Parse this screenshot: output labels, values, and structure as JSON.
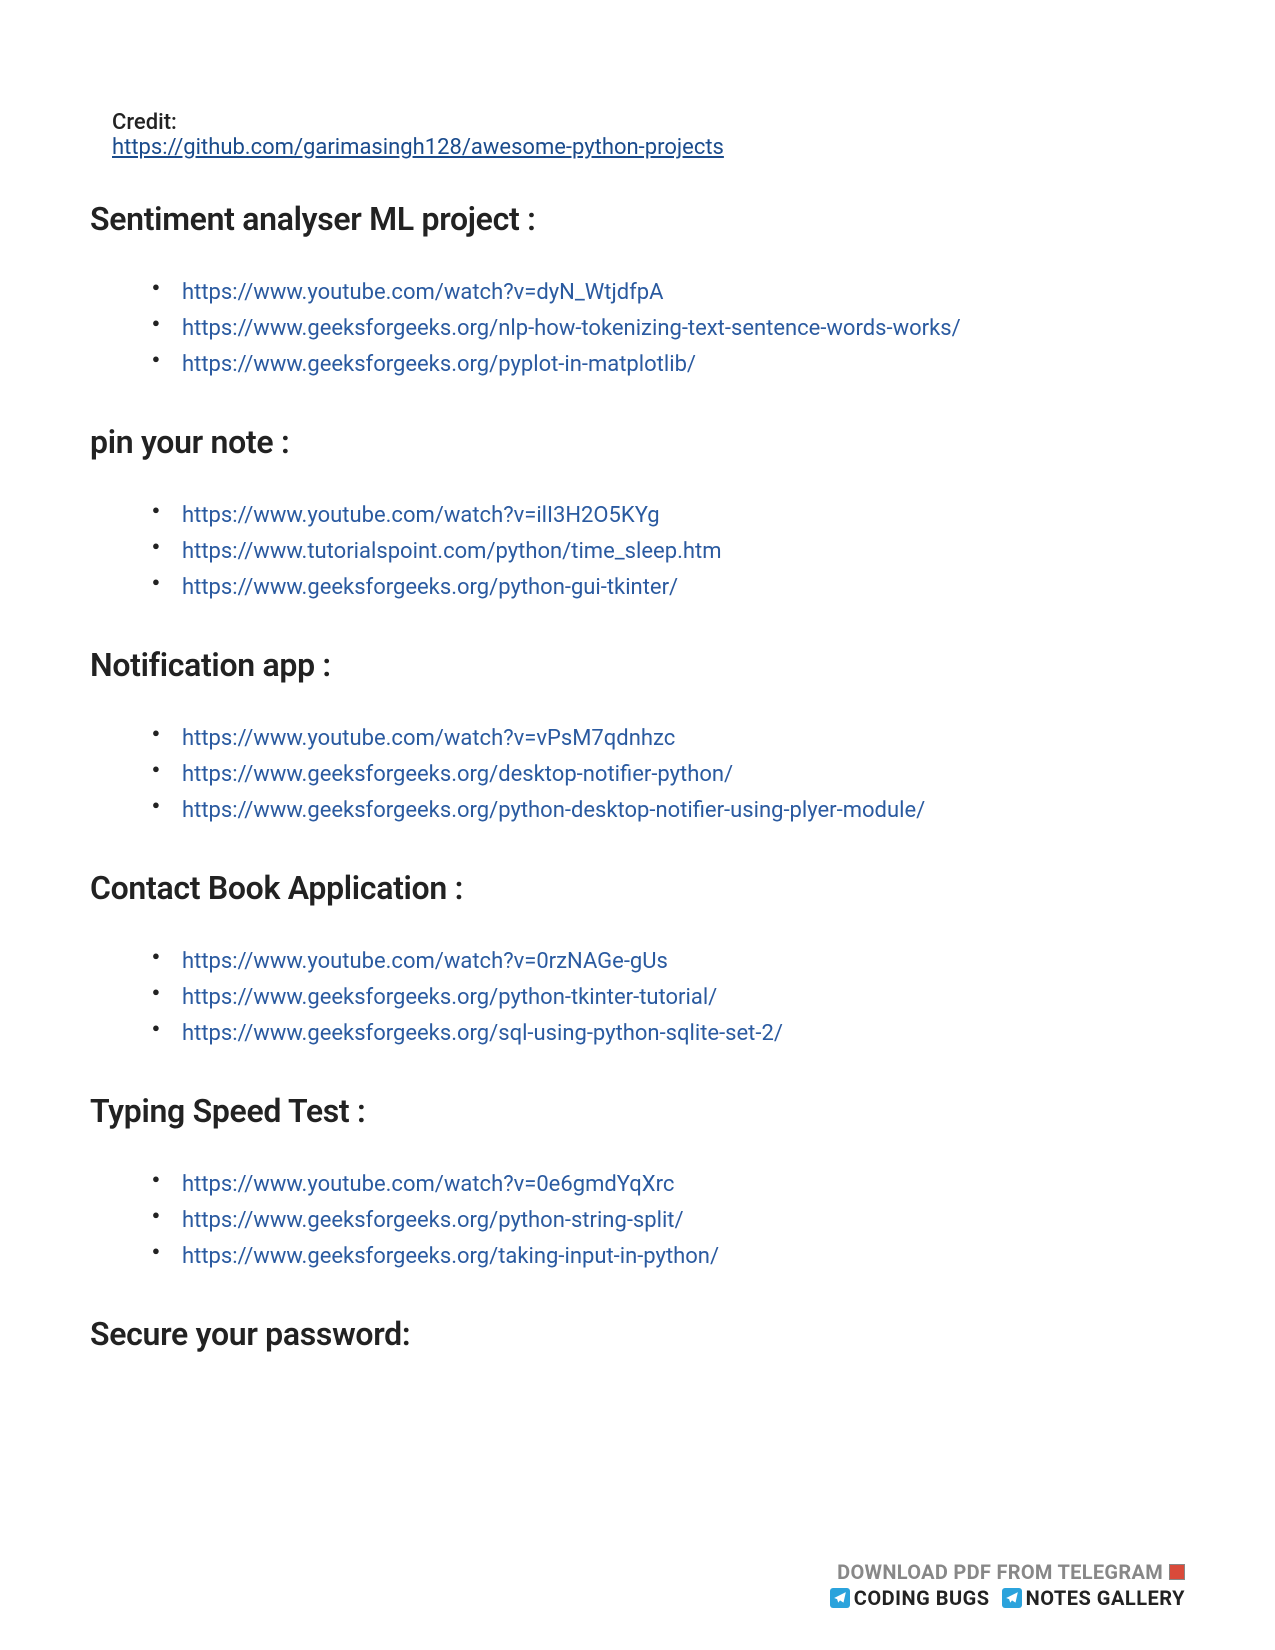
{
  "credit": {
    "label": "Credit:",
    "link": "https://github.com/garimasingh128/awesome-python-projects"
  },
  "sections": [
    {
      "heading": "Sentiment analyser ML project :",
      "links": [
        "https://www.youtube.com/watch?v=dyN_WtjdfpA",
        "https://www.geeksforgeeks.org/nlp-how-tokenizing-text-sentence-words-works/",
        "https://www.geeksforgeeks.org/pyplot-in-matplotlib/"
      ]
    },
    {
      "heading": "pin your note :",
      "links": [
        "https://www.youtube.com/watch?v=ilI3H2O5KYg",
        "https://www.tutorialspoint.com/python/time_sleep.htm",
        "https://www.geeksforgeeks.org/python-gui-tkinter/"
      ]
    },
    {
      "heading": "Notification app :",
      "links": [
        "https://www.youtube.com/watch?v=vPsM7qdnhzc",
        "https://www.geeksforgeeks.org/desktop-notifier-python/",
        "https://www.geeksforgeeks.org/python-desktop-notifier-using-plyer-module/"
      ]
    },
    {
      "heading": "Contact Book Application :",
      "links": [
        "https://www.youtube.com/watch?v=0rzNAGe-gUs",
        "https://www.geeksforgeeks.org/python-tkinter-tutorial/",
        "https://www.geeksforgeeks.org/sql-using-python-sqlite-set-2/"
      ]
    },
    {
      "heading": "Typing Speed Test :",
      "links": [
        "https://www.youtube.com/watch?v=0e6gmdYqXrc",
        "https://www.geeksforgeeks.org/python-string-split/",
        "https://www.geeksforgeeks.org/taking-input-in-python/"
      ]
    },
    {
      "heading": "Secure your password:",
      "links": []
    }
  ],
  "footer": {
    "line1": "DOWNLOAD PDF FROM TELEGRAM",
    "part1": "CODING BUGS",
    "part2": "NOTES GALLERY"
  }
}
